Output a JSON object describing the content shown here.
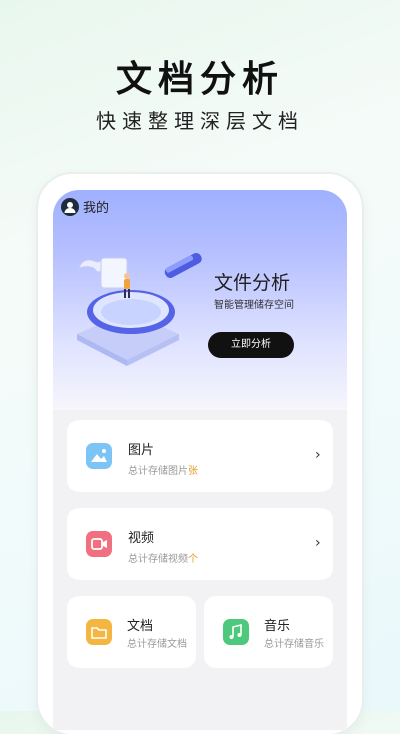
{
  "hero": {
    "title": "文档分析",
    "subtitle": "快速整理深层文档"
  },
  "header": {
    "me_label": "我的"
  },
  "analysis": {
    "title": "文件分析",
    "description": "智能管理储存空间",
    "button_label": "立即分析"
  },
  "items": [
    {
      "name": "图片",
      "desc": "总计存储图片",
      "unit": "张",
      "icon": "image-icon",
      "color": "#7cc4f5"
    },
    {
      "name": "视频",
      "desc": "总计存储视频",
      "unit": "个",
      "icon": "video-icon",
      "color": "#f0707f"
    },
    {
      "name": "文档",
      "desc": "总计存储文档",
      "unit": "",
      "icon": "folder-icon",
      "color": "#f5b641"
    },
    {
      "name": "音乐",
      "desc": "总计存储音乐",
      "unit": "",
      "icon": "music-icon",
      "color": "#4cc97c"
    }
  ]
}
